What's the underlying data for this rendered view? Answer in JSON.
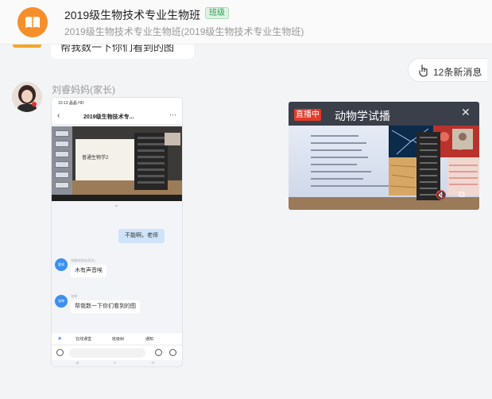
{
  "header": {
    "group_name": "2019级生物技术专业生物班",
    "badge": "班级",
    "subtitle": "2019级生物技术专业生物班(2019级生物技术专业生物班)"
  },
  "previous_message": {
    "text": "帮我数一下你们看到的图"
  },
  "new_messages": {
    "label": "12条新消息",
    "icon": "hand-pointer-icon"
  },
  "message": {
    "sender": "刘睿妈妈(家长)",
    "screenshot": {
      "status_time": "10:13 晶晶 HD",
      "nav_title": "2019级生物技术专...",
      "slide_text": "普通生物学2",
      "reply_right": "不能啊，老师",
      "sender_a_avatar": "爱成",
      "sender_a_meta": "张晨成爸爸(家长)",
      "sender_a_text": "木有声音唉",
      "sender_b_avatar": "张坤",
      "sender_b_meta": "张坤",
      "sender_b_text": "帮我数一下你们看到的图",
      "toolbar": {
        "online_class": "在线课堂",
        "growth_tree": "班级树",
        "notice": "通知"
      }
    }
  },
  "live": {
    "badge": "直播中",
    "title": "动物学试播",
    "close_icon": "close-icon",
    "mute_icon": "mute-icon",
    "fullscreen_icon": "fullscreen-icon"
  },
  "colors": {
    "accent_orange": "#f58f2c",
    "live_red": "#e23a2a",
    "badge_green": "#2ea05a"
  }
}
